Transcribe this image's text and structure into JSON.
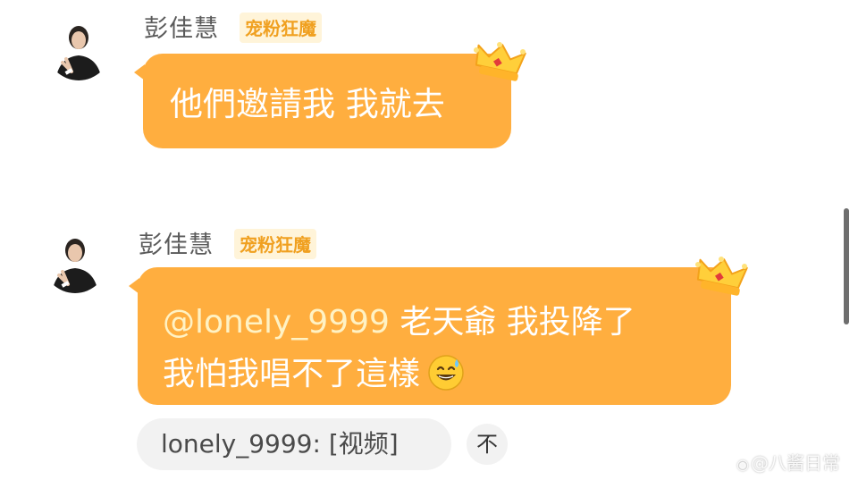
{
  "messages": [
    {
      "sender_name": "彭佳慧",
      "badge": "宠粉狂魔",
      "text": "他們邀請我 我就去"
    },
    {
      "sender_name": "彭佳慧",
      "badge": "宠粉狂魔",
      "mention": "@lonely_9999",
      "text_line1_rest": " 老天爺 我投降了",
      "text_line2": "我怕我唱不了這樣",
      "emoji": "sweat-smile-emoji",
      "reply_quote": "lonely_9999: [视频]",
      "fold_button": "不"
    }
  ],
  "watermark": "@八酱日常",
  "colors": {
    "bubble": "#ffae3f",
    "badge_text": "#f0a020",
    "badge_bg": "#fff4d9",
    "mention": "#fff2c4"
  }
}
